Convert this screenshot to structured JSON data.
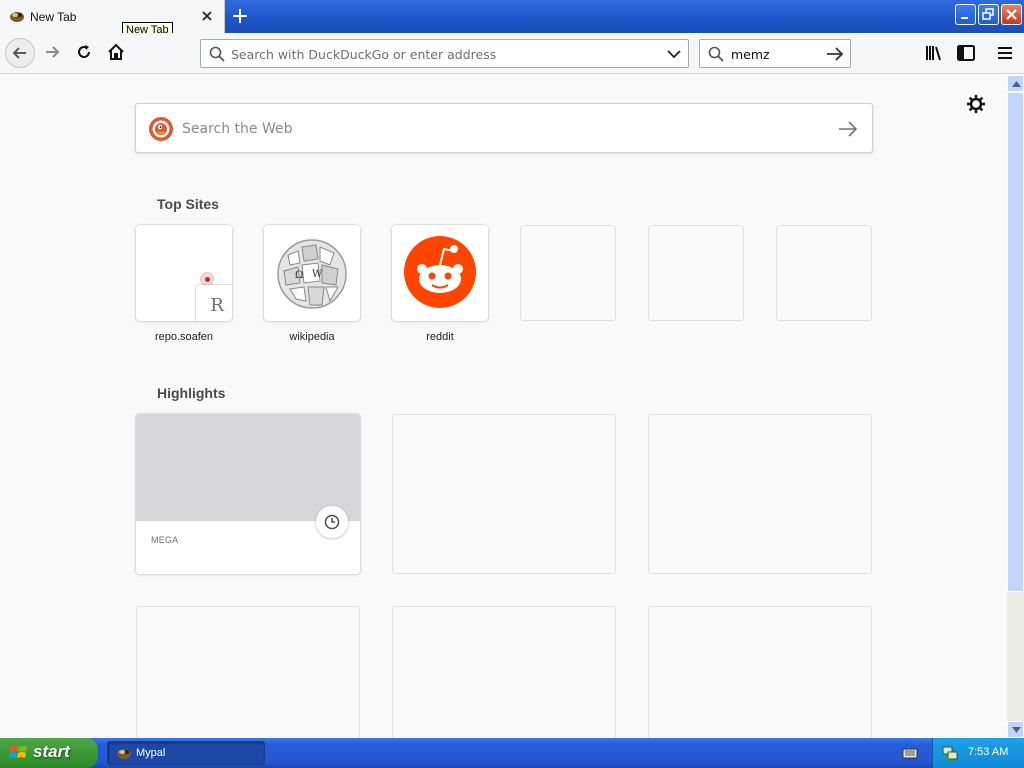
{
  "window": {
    "tab_title": "New Tab",
    "tooltip": "New Tab",
    "icons": [
      "browser-favicon",
      "close-tab-icon",
      "new-tab-plus-icon",
      "minimize-icon",
      "restore-icon",
      "close-window-icon"
    ]
  },
  "navbar": {
    "url_placeholder": "Search with DuckDuckGo or enter address",
    "search_value": "memz",
    "icons": [
      "back-arrow-icon",
      "forward-arrow-icon",
      "reload-icon",
      "home-icon",
      "search-icon",
      "dropdown-chevron-icon",
      "library-icon",
      "sidebar-icon",
      "hamburger-menu-icon"
    ]
  },
  "newtab": {
    "web_search_placeholder": "Search the Web",
    "top_sites_title": "Top Sites",
    "top_sites": [
      {
        "label": "repo.soafen",
        "letter": "R"
      },
      {
        "label": "wikipedia"
      },
      {
        "label": "reddit"
      },
      {
        "label": ""
      },
      {
        "label": ""
      },
      {
        "label": ""
      }
    ],
    "highlights_title": "Highlights",
    "highlights": [
      {
        "site": "MEGA"
      }
    ]
  },
  "taskbar": {
    "start_label": "start",
    "task_label": "Mypal",
    "clock": "7:53 AM"
  },
  "colors": {
    "xp_blue": "#245edb",
    "start_green": "#3a9a35",
    "reddit_orange": "#ff4500",
    "page_bg": "#f9f9fa"
  }
}
